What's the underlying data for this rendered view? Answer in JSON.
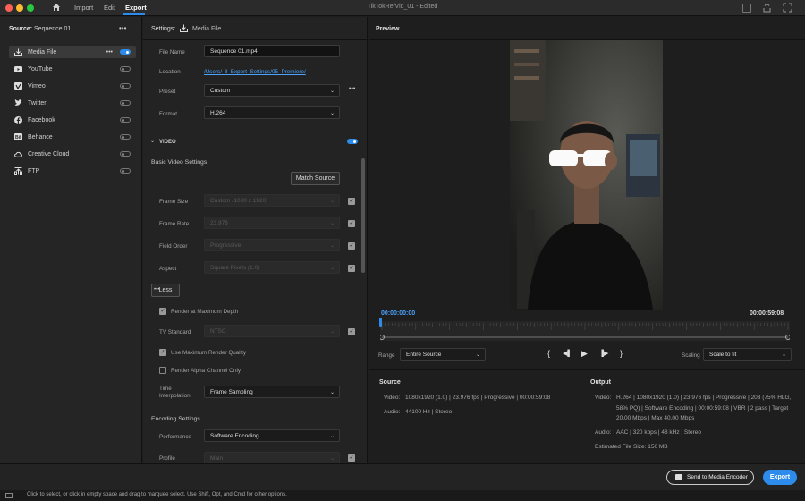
{
  "titlebar": {
    "nav": [
      "Import",
      "Edit",
      "Export"
    ],
    "window_title": "TikTokRefVid_01 - Edited"
  },
  "source": {
    "label": "Source:",
    "sequence": "Sequence 01",
    "more": "•••",
    "destinations": [
      {
        "icon": "media-file-icon",
        "label": "Media File",
        "enabled": true
      },
      {
        "icon": "youtube-icon",
        "label": "YouTube",
        "enabled": false
      },
      {
        "icon": "vimeo-icon",
        "label": "Vimeo",
        "enabled": false
      },
      {
        "icon": "twitter-icon",
        "label": "Twitter",
        "enabled": false
      },
      {
        "icon": "facebook-icon",
        "label": "Facebook",
        "enabled": false
      },
      {
        "icon": "behance-icon",
        "label": "Behance",
        "enabled": false
      },
      {
        "icon": "creative-cloud-icon",
        "label": "Creative Cloud",
        "enabled": false
      },
      {
        "icon": "ftp-icon",
        "label": "FTP",
        "enabled": false
      }
    ]
  },
  "settings": {
    "heading": "Settings:",
    "target": "Media File",
    "file_name_label": "File Name",
    "file_name_value": "Sequence 01.mp4",
    "location_label": "Location",
    "location_value": "/Users/_il_Export_Settings/05_Premiere/",
    "preset_label": "Preset",
    "preset_value": "Custom",
    "format_label": "Format",
    "format_value": "H.264",
    "video_section": "VIDEO",
    "basic_video_settings": "Basic Video Settings",
    "match_source": "Match Source",
    "frame_size_label": "Frame Size",
    "frame_size_value": "Custom (1080 x 1920)",
    "frame_rate_label": "Frame Rate",
    "frame_rate_value": "23.976",
    "field_order_label": "Field Order",
    "field_order_value": "Progressive",
    "aspect_label": "Aspect",
    "aspect_value": "Square Pixels (1.0)",
    "less_button": "Less",
    "render_max_depth": "Render at Maximum Depth",
    "tv_standard_label": "TV Standard",
    "tv_standard_value": "NTSC",
    "max_render_quality": "Use Maximum Render Quality",
    "render_alpha": "Render Alpha Channel Only",
    "time_interp_label_1": "Time",
    "time_interp_label_2": "Interpolation",
    "time_interp_value": "Frame Sampling",
    "encoding_settings": "Encoding Settings",
    "performance_label": "Performance",
    "performance_value": "Software Encoding",
    "profile_label": "Profile",
    "profile_value": "Main"
  },
  "preview": {
    "heading": "Preview",
    "timecode_start": "00:00:00:00",
    "timecode_end": "00:00:59:08",
    "range_label": "Range",
    "range_value": "Entire Source",
    "scaling_label": "Scaling",
    "scaling_value": "Scale to fit",
    "controls": [
      "{",
      "◀▌",
      "▶",
      "▐▶",
      "}"
    ]
  },
  "source_info": {
    "heading": "Source",
    "video_label": "Video:",
    "video_value": "1080x1920 (1.0)  |  23.976 fps  |  Progressive  |  00:00:59:08",
    "audio_label": "Audio:",
    "audio_value": "44100 Hz  |  Stereo"
  },
  "output_info": {
    "heading": "Output",
    "video_label": "Video:",
    "video_line1": "H.264  |  1080x1920 (1.0)  |  23.976 fps  |  Progressive  |  203 (75% HLG,",
    "video_line2": "58% PQ)  |  Software Encoding  |  00:00:59:08  |  VBR  |  2 pass  |  Target",
    "video_line3": "20.00 Mbps  |  Max 40.00 Mbps",
    "audio_label": "Audio:",
    "audio_value": "AAC  |  320 kbps  |  48 kHz  |  Stereo",
    "file_size": "Estimated File Size:  150 MB"
  },
  "footer": {
    "send_button": "Send to Media Encoder",
    "export_button": "Export",
    "status": "Click to select, or click in empty space and drag to marquee select. Use Shift, Opt, and Cmd for other options."
  },
  "colors": {
    "accent": "#2d8ceb",
    "background": "#1e1e1e"
  }
}
